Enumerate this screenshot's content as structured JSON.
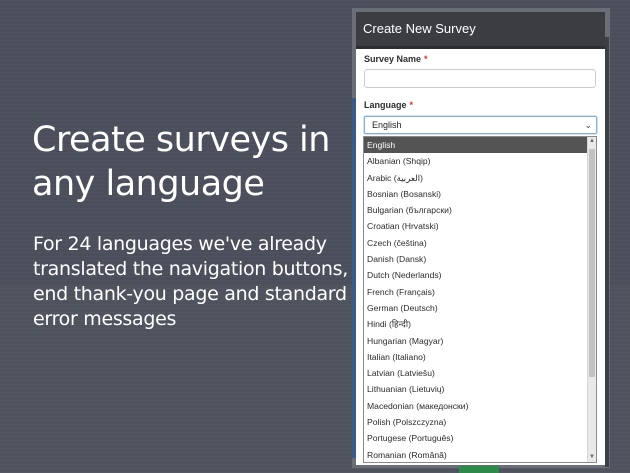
{
  "hero": {
    "title": "Create surveys in any language",
    "subtitle": "For 24 languages we've already translated the navigation buttons, end thank-you page and standard error messages"
  },
  "modal": {
    "title": "Create New Survey",
    "survey_name_label": "Survey Name",
    "required_mark": "*",
    "survey_name_value": "",
    "language_label": "Language",
    "language_selected": "English",
    "language_options": [
      "English",
      "Albanian (Shqip)",
      "Arabic (العربية)",
      "Bosnian (Bosanski)",
      "Bulgarian (български)",
      "Croatian (Hrvatski)",
      "Czech (čeština)",
      "Danish (Dansk)",
      "Dutch (Nederlands)",
      "French (Français)",
      "German (Deutsch)",
      "Hindi (हिन्दी)",
      "Hungarian (Magyar)",
      "Italian (Italiano)",
      "Latvian (Latviešu)",
      "Lithuanian (Lietuvių)",
      "Macedonian (македонски)",
      "Polish (Polszczyzna)",
      "Portugese (Português)",
      "Romanian (Română)"
    ]
  },
  "icons": {
    "select_chevron": "chevron-down-icon",
    "scroll_up": "caret-up-icon",
    "scroll_down": "caret-down-icon"
  }
}
